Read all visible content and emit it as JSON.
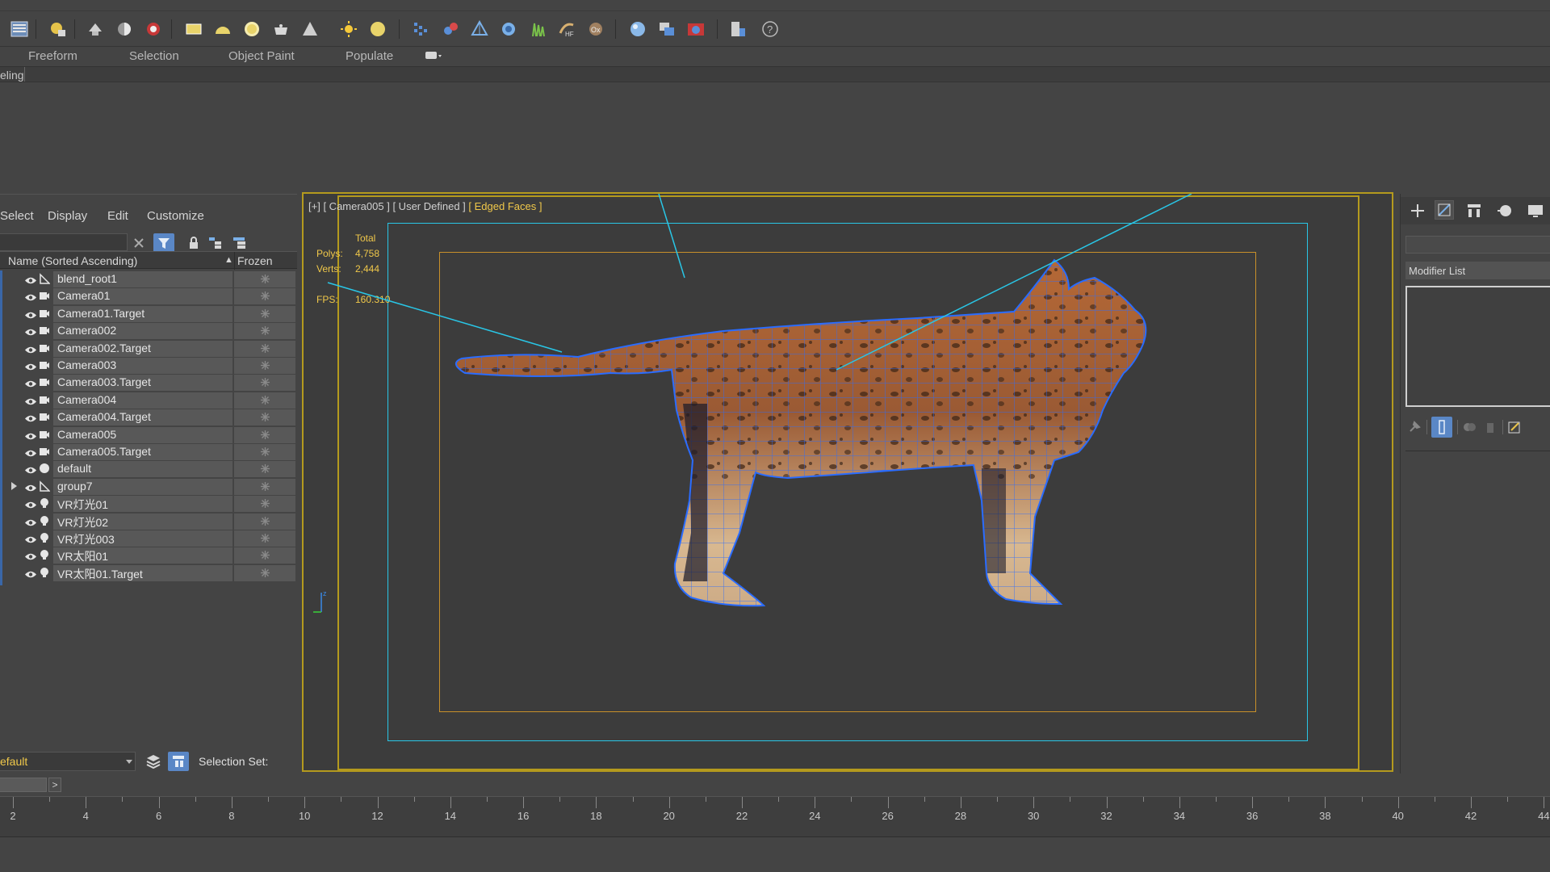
{
  "ribbon": {
    "tabs": [
      "Freeform",
      "Selection",
      "Object Paint",
      "Populate"
    ],
    "panel_label": "eling"
  },
  "scene_explorer": {
    "menu": [
      "Select",
      "Display",
      "Edit",
      "Customize"
    ],
    "header_name": "Name (Sorted Ascending)",
    "header_frozen": "Frozen",
    "sort_indicator": "▲",
    "items": [
      {
        "label": "blend_root1",
        "type": "bone"
      },
      {
        "label": "Camera01",
        "type": "camera"
      },
      {
        "label": "Camera01.Target",
        "type": "camera"
      },
      {
        "label": "Camera002",
        "type": "camera"
      },
      {
        "label": "Camera002.Target",
        "type": "camera"
      },
      {
        "label": "Camera003",
        "type": "camera"
      },
      {
        "label": "Camera003.Target",
        "type": "camera"
      },
      {
        "label": "Camera004",
        "type": "camera"
      },
      {
        "label": "Camera004.Target",
        "type": "camera"
      },
      {
        "label": "Camera005",
        "type": "camera"
      },
      {
        "label": "Camera005.Target",
        "type": "camera"
      },
      {
        "label": "default",
        "type": "geometry"
      },
      {
        "label": "group7",
        "type": "bone",
        "expandable": true
      },
      {
        "label": "VR灯光01",
        "type": "light"
      },
      {
        "label": "VR灯光02",
        "type": "light"
      },
      {
        "label": "VR灯光003",
        "type": "light"
      },
      {
        "label": "VR太阳01",
        "type": "light"
      },
      {
        "label": "VR太阳01.Target",
        "type": "light"
      }
    ],
    "layer_value": "efault",
    "selection_set_label": "Selection Set:"
  },
  "viewport": {
    "label_plus": "[+]",
    "label_camera": "[ Camera005 ]",
    "label_defined": "[ User Defined ]",
    "label_shading": "[ Edged Faces ]",
    "stats": {
      "total_label": "Total",
      "polys_label": "Polys:",
      "polys_value": "4,758",
      "verts_label": "Verts:",
      "verts_value": "2,444",
      "fps_label": "FPS:",
      "fps_value": "160.310"
    }
  },
  "command_panel": {
    "modifier_list_label": "Modifier List"
  },
  "time_slider": {
    "next_label": ">"
  },
  "track_bar": {
    "ticks": [
      "2",
      "4",
      "6",
      "8",
      "10",
      "12",
      "14",
      "16",
      "18",
      "20",
      "22",
      "24",
      "26",
      "28",
      "30",
      "32",
      "34",
      "36",
      "38",
      "40",
      "42",
      "44"
    ]
  },
  "colors": {
    "accent_yellow": "#f0c84a",
    "viewport_border": "#b49a1e",
    "safe_frame_cyan": "#29c6e6",
    "safe_frame_orange": "#c8902a",
    "wireframe_blue": "#2a6cff",
    "selected_button": "#5a87c6"
  }
}
